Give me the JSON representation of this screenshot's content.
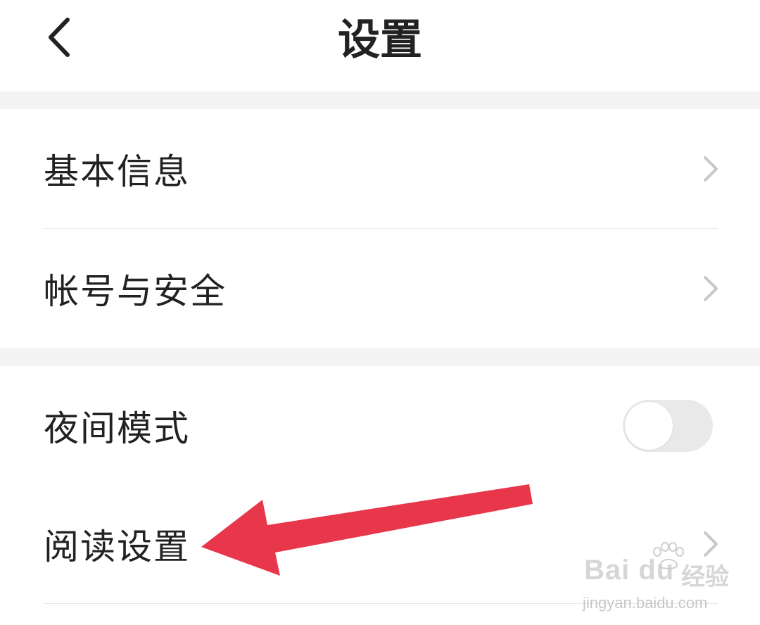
{
  "header": {
    "title": "设置",
    "back_icon": "chevron-left-icon"
  },
  "settings": {
    "basic_info": {
      "label": "基本信息",
      "icon": "chevron-right-icon"
    },
    "account_security": {
      "label": "帐号与安全",
      "icon": "chevron-right-icon"
    },
    "night_mode": {
      "label": "夜间模式",
      "enabled": false
    },
    "reading_settings": {
      "label": "阅读设置",
      "icon": "chevron-right-icon"
    }
  },
  "annotation": {
    "arrow_color": "#e8364a",
    "points_to": "阅读设置"
  },
  "watermark": {
    "brand": "Bai du",
    "suffix": "经验",
    "url": "jingyan.baidu.com"
  },
  "colors": {
    "background": "#ffffff",
    "section_gap": "#f4f4f4",
    "text": "#222222",
    "chevron": "#c8c8c8",
    "toggle_off": "#e9e9e9"
  }
}
